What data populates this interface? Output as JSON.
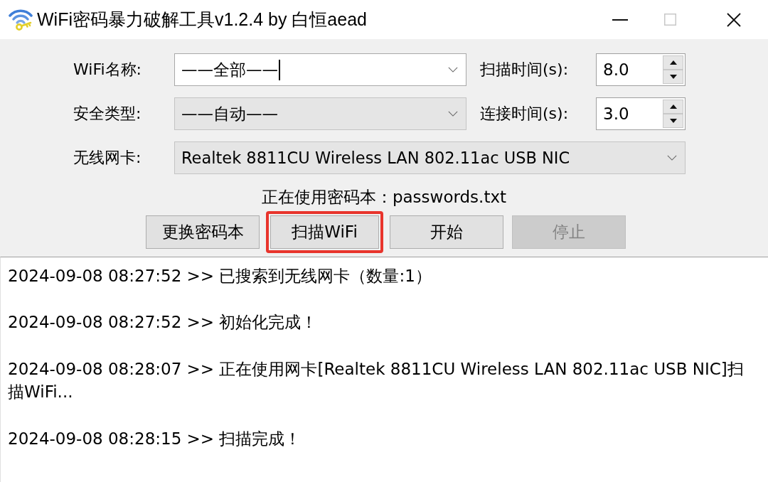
{
  "window": {
    "title": "WiFi密码暴力破解工具v1.2.4 by 白恒aead",
    "controls": [
      {
        "kind": "minimize",
        "disabled": false
      },
      {
        "kind": "maximize",
        "disabled": true
      },
      {
        "kind": "close",
        "disabled": false
      }
    ]
  },
  "form": {
    "rows": [
      {
        "label": "WiFi名称:",
        "combo": {
          "value": "——全部——",
          "editable": true,
          "focused": true
        },
        "spin": {
          "label": "扫描时间(s):",
          "value": "8.0"
        }
      },
      {
        "label": "安全类型:",
        "combo": {
          "value": "——自动——",
          "editable": false,
          "focused": false
        },
        "spin": {
          "label": "连接时间(s):",
          "value": "3.0"
        }
      },
      {
        "label": "无线网卡:",
        "combo": {
          "value": "Realtek 8811CU Wireless LAN 802.11ac USB NIC",
          "editable": false,
          "focused": false
        }
      }
    ],
    "password_file": "正在使用密码本：passwords.txt"
  },
  "buttons": [
    {
      "label": "更换密码本",
      "disabled": false,
      "highlighted": false
    },
    {
      "label": "扫描WiFi",
      "disabled": false,
      "highlighted": true
    },
    {
      "label": "开始",
      "disabled": false,
      "highlighted": false
    },
    {
      "label": "停止",
      "disabled": true,
      "highlighted": false
    }
  ],
  "log": [
    "2024-09-08 08:27:52 >> 已搜索到无线网卡（数量:1）",
    "2024-09-08 08:27:52 >> 初始化完成！",
    "2024-09-08 08:28:07 >> 正在使用网卡[Realtek 8811CU Wireless LAN 802.11ac USB NIC]扫描WiFi...",
    "2024-09-08 08:28:15 >> 扫描完成！"
  ]
}
